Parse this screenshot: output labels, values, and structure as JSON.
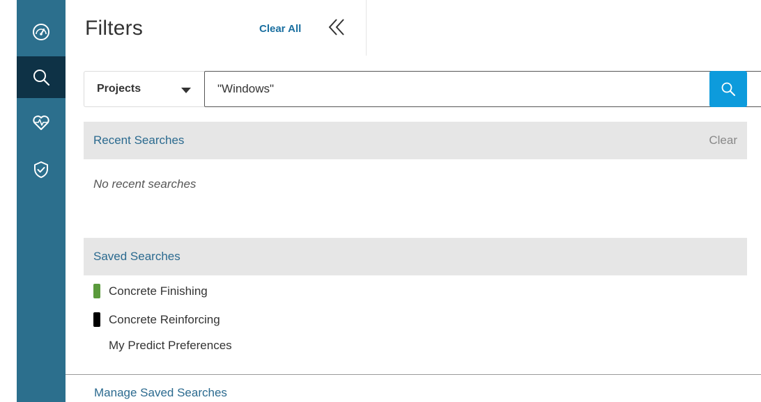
{
  "nav": {
    "items": [
      {
        "name": "dashboard-icon",
        "active": false
      },
      {
        "name": "search-icon",
        "active": true
      },
      {
        "name": "heart-pulse-icon",
        "active": false
      },
      {
        "name": "shield-check-icon",
        "active": false
      }
    ],
    "colors": {
      "rail": "#2c6f8d",
      "active": "#0e3246"
    }
  },
  "filters": {
    "title": "Filters",
    "clear_all_label": "Clear All",
    "collapse_icon": "double-chevron-left-icon"
  },
  "search": {
    "scope_value": "Projects",
    "query_value": "\"Windows\"",
    "clear_icon": "circle-x-icon",
    "button_icon": "search-icon",
    "button_color": "#0d9bdc"
  },
  "recent": {
    "title": "Recent Searches",
    "clear_label": "Clear",
    "empty_text": "No recent searches"
  },
  "saved": {
    "title": "Saved Searches",
    "items": [
      {
        "label": "Concrete Finishing",
        "color": "#5a9a3c"
      },
      {
        "label": "Concrete Reinforcing",
        "color": "#000000"
      },
      {
        "label": "My Predict Preferences",
        "color": ""
      }
    ],
    "manage_label": "Manage Saved Searches"
  }
}
